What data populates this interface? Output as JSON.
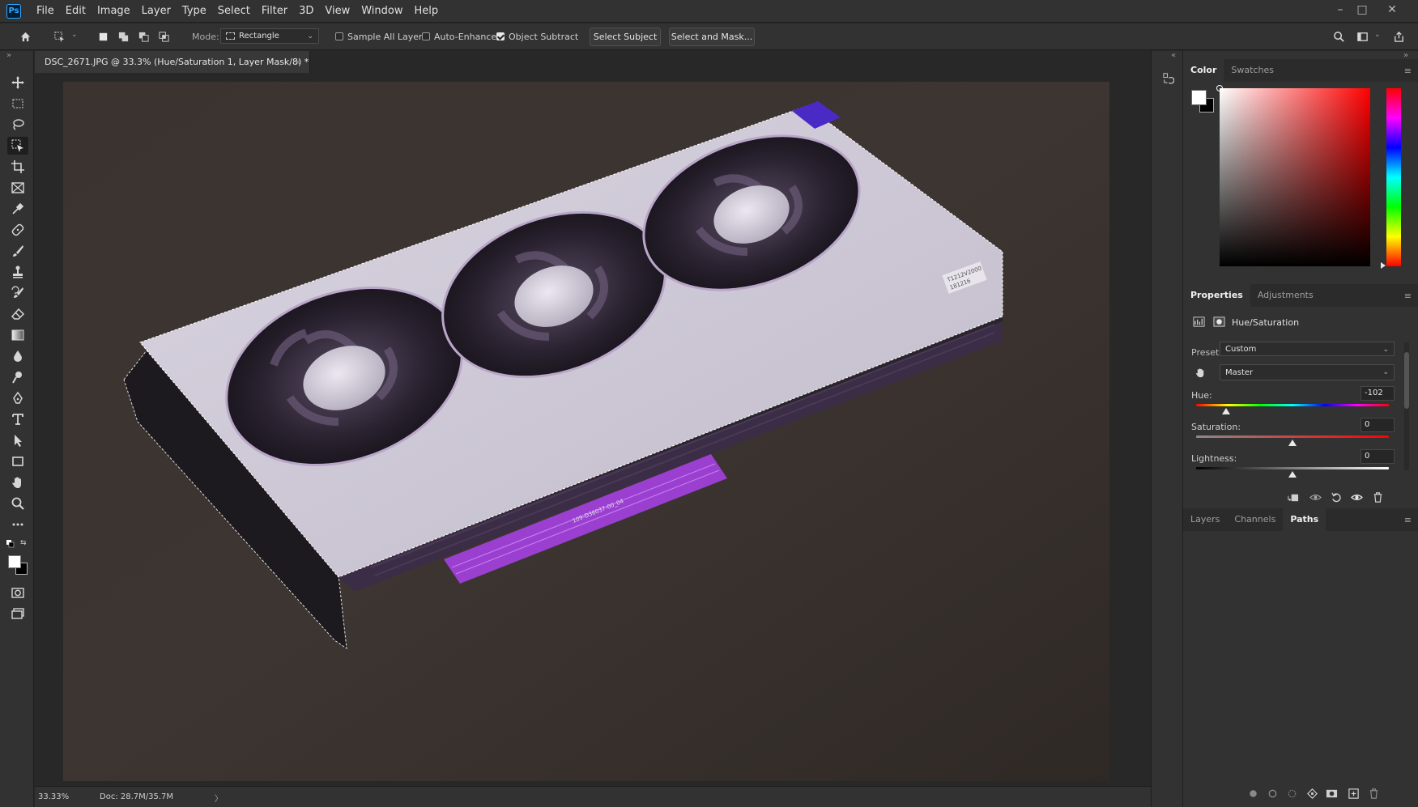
{
  "menubar": {
    "logo": "Ps",
    "items": [
      "File",
      "Edit",
      "Image",
      "Layer",
      "Type",
      "Select",
      "Filter",
      "3D",
      "View",
      "Window",
      "Help"
    ],
    "window_controls": [
      "–",
      "□",
      "✕"
    ]
  },
  "options": {
    "mode_label": "Mode:",
    "mode_value": "Rectangle",
    "sample_all_layers": "Sample All Layers",
    "auto_enhance": "Auto-Enhance",
    "object_subtract": "Object Subtract",
    "select_subject": "Select Subject",
    "select_and_mask": "Select and Mask..."
  },
  "document": {
    "tab_title": "DSC_2671.JPG @ 33.3% (Hue/Saturation 1, Layer Mask/8) *",
    "close": "×"
  },
  "status": {
    "zoom": "33.33%",
    "doc_size": "Doc: 28.7M/35.7M",
    "arrow": "〉"
  },
  "color_panel": {
    "tabs": [
      "Color",
      "Swatches"
    ],
    "foreground": "#ffffff",
    "background": "#000000",
    "hue_base": "#ff0000"
  },
  "properties": {
    "tabs": [
      "Properties",
      "Adjustments"
    ],
    "layer_title": "Hue/Saturation",
    "preset_label": "Preset:",
    "preset_value": "Custom",
    "channel_value": "Master",
    "hue_label": "Hue:",
    "hue_value": "-102",
    "hue_level": 0.155,
    "saturation_label": "Saturation:",
    "saturation_value": "0",
    "saturation_level": 0.5,
    "lightness_label": "Lightness:",
    "lightness_value": "0",
    "lightness_level": 0.5
  },
  "layers_panel": {
    "tabs": [
      "Layers",
      "Channels",
      "Paths"
    ],
    "active_tab": "Paths"
  },
  "image": {
    "card_label_1": "T1212V2000",
    "card_label_2": "181216",
    "pcb_text": "109-D36037-00_04"
  },
  "colors": {
    "accent": "#31a8ff",
    "panel_bg": "#323232",
    "app_bg": "#282828",
    "tint": "#a020f0"
  }
}
